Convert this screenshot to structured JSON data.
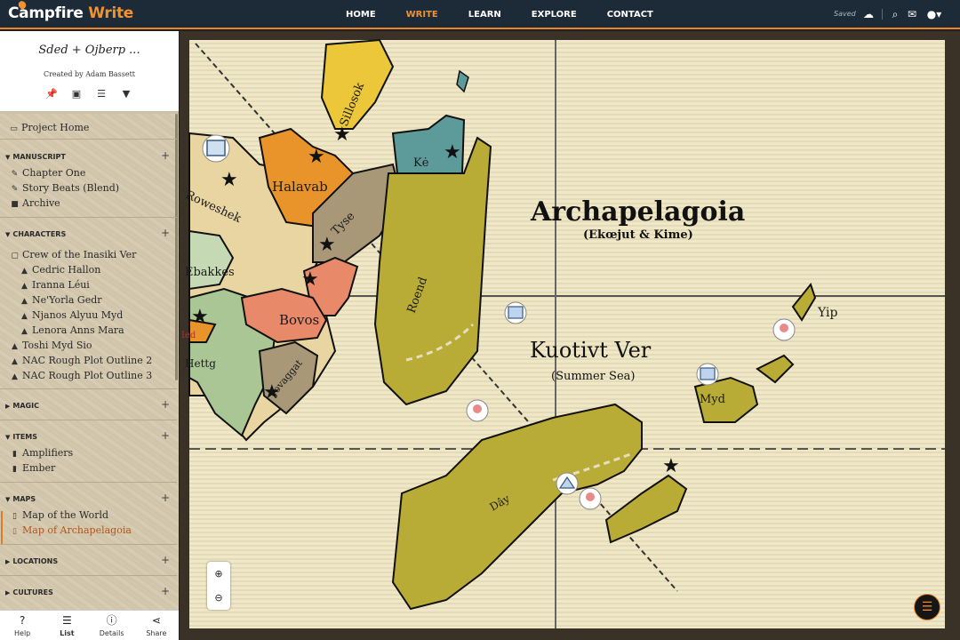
{
  "app": {
    "logo_main": "Campfire",
    "logo_accent": "Write"
  },
  "nav": {
    "home": "HOME",
    "write": "WRITE",
    "learn": "LEARN",
    "explore": "EXPLORE",
    "contact": "CONTACT"
  },
  "status": {
    "saved": "Saved"
  },
  "project": {
    "title": "Sded + Ojberp ...",
    "author": "Created by Adam Bassett"
  },
  "tree": {
    "project_home": "Project Home",
    "manuscript": {
      "label": "MANUSCRIPT",
      "items": [
        "Chapter One",
        "Story Beats (Blend)",
        "Archive"
      ]
    },
    "characters": {
      "label": "CHARACTERS",
      "folder": "Crew of the Inasiki Ver",
      "folder_items": [
        "Cedric Hallon",
        "Iranna Léui",
        "Ne'Yorla Gedr",
        "Njanos Alyuu Myd",
        "Lenora Anns Mara"
      ],
      "items": [
        "Toshi Myd Sio",
        "NAC Rough Plot Outline 2",
        "NAC Rough Plot Outline 3"
      ]
    },
    "magic": {
      "label": "MAGIC"
    },
    "items_sec": {
      "label": "ITEMS",
      "items": [
        "Amplifiers",
        "Ember"
      ]
    },
    "maps": {
      "label": "MAPS",
      "items": [
        "Map of the World",
        "Map of Archapelagoia"
      ]
    },
    "locations": {
      "label": "LOCATIONS"
    },
    "cultures": {
      "label": "CULTURES"
    }
  },
  "bottom_tabs": {
    "help": "Help",
    "list": "List",
    "details": "Details",
    "share": "Share"
  },
  "map": {
    "title": "Archapelagoia",
    "subtitle": "(Ekœjut & Kime)",
    "sea": "Kuotivt Ver",
    "sea_sub": "(Summer Sea)",
    "regions": [
      "Sillosok",
      "Kė",
      "Halavab",
      "Roweshek",
      "Tyse",
      "Ebakkes",
      "Roend",
      "Bovos",
      "Ied",
      "Hettg",
      "Jovaggat",
      "Yip",
      "Myd",
      "Dây"
    ]
  },
  "colors": {
    "accent": "#f0922f",
    "nav_bg": "#1d2b38",
    "land_main": "#b9ac36"
  },
  "icons": {
    "pin": "pin-icon",
    "folder_add": "folder-add-icon",
    "stack": "stack-icon",
    "filter": "filter-icon"
  }
}
